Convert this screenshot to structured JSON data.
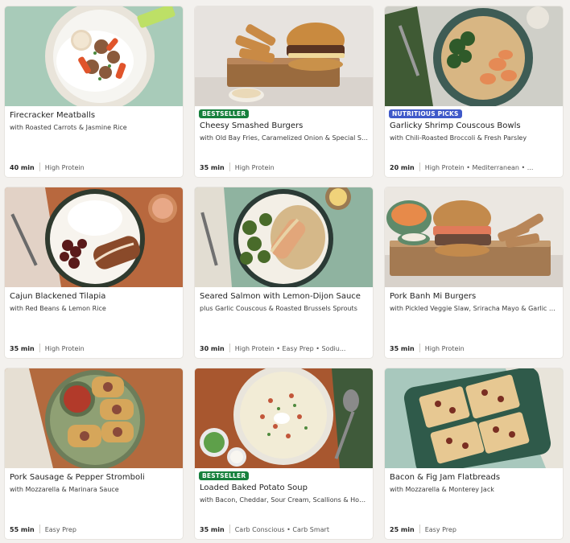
{
  "badge_colors": {
    "bestseller": "#16803c",
    "nutritious": "#3f59c9"
  },
  "recipes": [
    {
      "title": "Firecracker Meatballs",
      "subtitle": "with Roasted Carrots & Jasmine Rice",
      "time": "40 min",
      "tags": "High Protein",
      "badge": "",
      "image": "meatballs-rice-bowl"
    },
    {
      "title": "Cheesy Smashed Burgers",
      "subtitle": "with Old Bay Fries, Caramelized Onion & Special Sa...",
      "time": "35 min",
      "tags": "High Protein",
      "badge": "BESTSELLER",
      "image": "smashed-burger-fries"
    },
    {
      "title": "Garlicky Shrimp Couscous Bowls",
      "subtitle": "with Chili-Roasted Broccoli & Fresh Parsley",
      "time": "20 min",
      "tags": "High Protein • Mediterranean • ...",
      "badge": "NUTRITIOUS PICKS",
      "image": "shrimp-couscous-bowl"
    },
    {
      "title": "Cajun Blackened Tilapia",
      "subtitle": "with Red Beans & Lemon Rice",
      "time": "35 min",
      "tags": "High Protein",
      "badge": "",
      "image": "tilapia-rice-beans"
    },
    {
      "title": "Seared Salmon with Lemon-Dijon Sauce",
      "subtitle": "plus Garlic Couscous & Roasted Brussels Sprouts",
      "time": "30 min",
      "tags": "High Protein • Easy Prep • Sodiu...",
      "badge": "",
      "image": "salmon-couscous-sprouts"
    },
    {
      "title": "Pork Banh Mi Burgers",
      "subtitle": "with Pickled Veggie Slaw, Sriracha Mayo & Garlic Po...",
      "time": "35 min",
      "tags": "High Protein",
      "badge": "",
      "image": "banh-mi-burger"
    },
    {
      "title": "Pork Sausage & Pepper Stromboli",
      "subtitle": "with Mozzarella & Marinara Sauce",
      "time": "55 min",
      "tags": "Easy Prep",
      "badge": "",
      "image": "stromboli-marinara"
    },
    {
      "title": "Loaded Baked Potato Soup",
      "subtitle": "with Bacon, Cheddar, Sour Cream, Scallions & Hot S...",
      "time": "35 min",
      "tags": "Carb Conscious • Carb Smart",
      "badge": "BESTSELLER",
      "image": "potato-soup"
    },
    {
      "title": "Bacon & Fig Jam Flatbreads",
      "subtitle": "with Mozzarella & Monterey Jack",
      "time": "25 min",
      "tags": "Easy Prep",
      "badge": "",
      "image": "fig-flatbreads"
    }
  ]
}
